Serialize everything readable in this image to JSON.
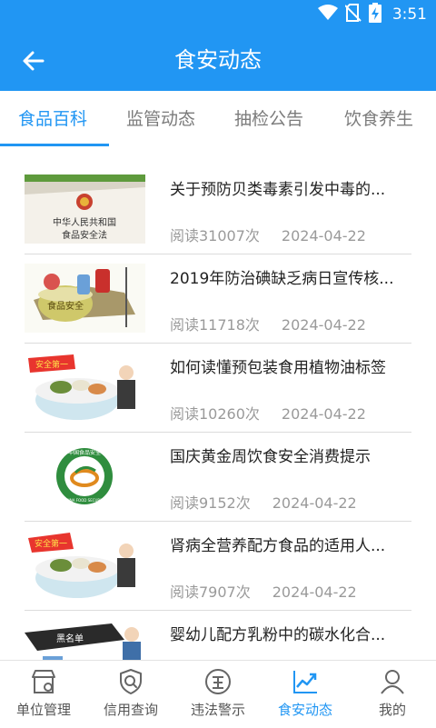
{
  "status_bar": {
    "time": "3:51",
    "icons": [
      "wifi-icon",
      "no-sim-icon",
      "battery-charging-icon"
    ]
  },
  "app_bar": {
    "title": "食安动态",
    "back_icon": "arrow-left-icon"
  },
  "tabs": [
    {
      "label": "食品百科",
      "active": true
    },
    {
      "label": "监管动态",
      "active": false
    },
    {
      "label": "抽检公告",
      "active": false
    },
    {
      "label": "饮食养生",
      "active": false
    }
  ],
  "articles": [
    {
      "title": "关于预防贝类毒素引发中毒的...",
      "reads": "阅读31007次",
      "date": "2024-04-22",
      "thumb": "food-safety-law-book",
      "thumb_text": [
        "中华人民共和国",
        "食品安全法"
      ]
    },
    {
      "title": "2019年防治碘缺乏病日宣传核...",
      "reads": "阅读11718次",
      "date": "2024-04-22",
      "thumb": "food-safety-bowl-cartoon",
      "thumb_text": [
        "食品安全"
      ]
    },
    {
      "title": "如何读懂预包装食用植物油标签",
      "reads": "阅读10260次",
      "date": "2024-04-22",
      "thumb": "safety-first-rice-bowl-cartoon",
      "thumb_text": [
        "安全第一"
      ]
    },
    {
      "title": "国庆黄金周饮食安全消费提示",
      "reads": "阅读9152次",
      "date": "2024-04-22",
      "thumb": "china-food-security-logo",
      "thumb_text": [
        "中国食品安全",
        "CHINA FOOD SECURITY"
      ]
    },
    {
      "title": "肾病全营养配方食品的适用人...",
      "reads": "阅读7907次",
      "date": "2024-04-22",
      "thumb": "safety-first-rice-bowl-cartoon",
      "thumb_text": [
        "安全第一"
      ]
    },
    {
      "title": "婴幼儿配方乳粉中的碳水化合...",
      "reads": "",
      "date": "",
      "thumb": "blacklist-cartoon",
      "thumb_text": [
        "黑名单"
      ]
    }
  ],
  "bottom_nav": [
    {
      "label": "单位管理",
      "icon": "storefront-gear-icon",
      "active": false
    },
    {
      "label": "信用查询",
      "icon": "shield-search-icon",
      "active": false
    },
    {
      "label": "违法警示",
      "icon": "violation-warning-icon",
      "active": false
    },
    {
      "label": "食安动态",
      "icon": "trend-chart-icon",
      "active": true
    },
    {
      "label": "我的",
      "icon": "person-icon",
      "active": false
    }
  ],
  "colors": {
    "primary": "#2196f3",
    "text_dark": "#222222",
    "text_muted": "#9a9a9a",
    "divider": "#dcdcdc"
  }
}
